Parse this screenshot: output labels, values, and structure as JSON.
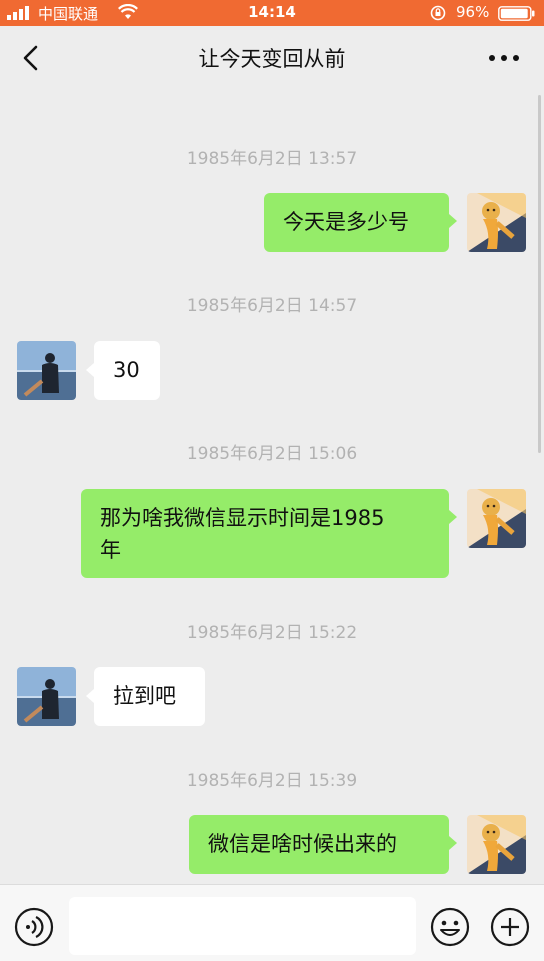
{
  "status_bar": {
    "carrier": "中国联通",
    "time": "14:14",
    "battery_percent": "96%",
    "battery_level": 0.96,
    "bar_color": "#f06a32"
  },
  "header": {
    "title": "让今天变回从前",
    "back_icon": "chevron-left-icon",
    "more_icon": "more-dots-icon"
  },
  "chat": {
    "timestamps": [
      "1985年6月2日 13:57",
      "1985年6月2日 14:57",
      "1985年6月2日 15:06",
      "1985年6月2日 15:22",
      "1985年6月2日 15:39"
    ],
    "messages": [
      {
        "sender": "me",
        "text": "今天是多少号"
      },
      {
        "sender": "other",
        "text": "30"
      },
      {
        "sender": "me",
        "text_line1": "那为啥我微信显示时间是1985",
        "text_line2": "年"
      },
      {
        "sender": "other",
        "text": "拉到吧"
      },
      {
        "sender": "me",
        "text": "微信是啥时候出来的"
      }
    ],
    "colors": {
      "my_bubble": "#95ec69",
      "other_bubble": "#ffffff",
      "background": "#ededed"
    }
  },
  "input_bar": {
    "placeholder": "",
    "voice_icon": "voice-icon",
    "emoji_icon": "emoji-icon",
    "plus_icon": "plus-icon"
  }
}
